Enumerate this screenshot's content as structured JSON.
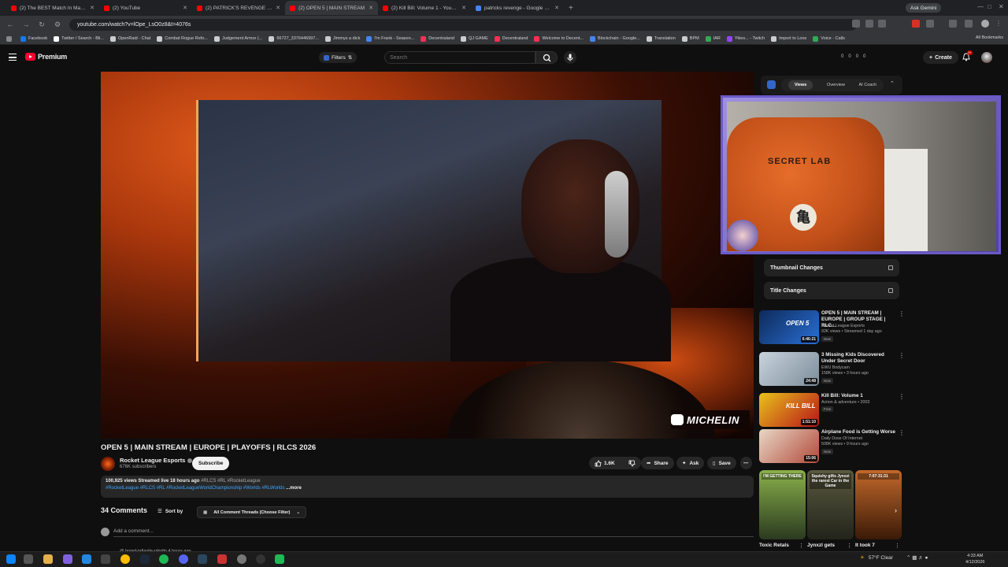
{
  "browser": {
    "tabs": [
      {
        "title": "(2) The BEST Match In Mario Ka",
        "color": "#ff0000"
      },
      {
        "title": "(2) YouTube",
        "color": "#ff0000"
      },
      {
        "title": "(2) PATRICK'S REVENGE [Ohhh",
        "color": "#ff0000"
      },
      {
        "title": "(2) OPEN 5 | MAIN STREAM",
        "color": "#ff0000",
        "active": true
      },
      {
        "title": "(2) Kill Bill: Volume 1 - YouTube",
        "color": "#ff0000"
      },
      {
        "title": "patricks revenge - Google Sear",
        "color": "#4285f4"
      }
    ],
    "new_tab": "+",
    "ask_gemini": "Ask Gemini",
    "url": "youtube.com/watch?v=lOpe_LsO0z8&t=4076s",
    "bookmarks": [
      {
        "label": "Facebook",
        "color": "#1877f2"
      },
      {
        "label": "Twitter / Search - Bli...",
        "color": "#ffffff"
      },
      {
        "label": "OpenRaid - Chat",
        "color": "#cccccc"
      },
      {
        "label": "Combat Rogue Refo...",
        "color": "#cccccc"
      },
      {
        "label": "Judgement Armor (...",
        "color": "#cccccc"
      },
      {
        "label": "66727_3376446997...",
        "color": "#cccccc"
      },
      {
        "label": "Jimmys a dick",
        "color": "#cccccc"
      },
      {
        "label": "I'm Frank - Season...",
        "color": "#4285f4"
      },
      {
        "label": "Decentraland",
        "color": "#ff2d55"
      },
      {
        "label": "QJ GAME",
        "color": "#cccccc"
      },
      {
        "label": "Decentraland",
        "color": "#ff2d55"
      },
      {
        "label": "Welcome to Decent...",
        "color": "#ff2d55"
      },
      {
        "label": "Blockchain - Google...",
        "color": "#4285f4"
      },
      {
        "label": "Translation",
        "color": "#cccccc"
      },
      {
        "label": "BPM",
        "color": "#cccccc"
      },
      {
        "label": "IAR",
        "color": "#34a853"
      },
      {
        "label": "Yikes... - Twitch",
        "color": "#9146ff"
      },
      {
        "label": "Import to Loox",
        "color": "#cccccc"
      },
      {
        "label": "Voice - Calls",
        "color": "#34a853"
      }
    ],
    "all_bookmarks": "All Bookmarks"
  },
  "youtube": {
    "logo_text": "Premium",
    "filters_label": "Filters",
    "search_placeholder": "Search",
    "header_stats": [
      "0",
      "0",
      "0",
      "0"
    ],
    "create_label": "Create",
    "notif_count": "9+"
  },
  "video": {
    "sponsor": "MICHELIN",
    "title": "OPEN 5 | MAIN STREAM | EUROPE | PLAYOFFS | RLCS 2026",
    "channel": "Rocket League Esports",
    "subscribers": "676K subscribers",
    "subscribe_label": "Subscribe",
    "likes": "1.6K",
    "share_label": "Share",
    "ask_label": "Ask",
    "save_label": "Save",
    "desc_line1_stats": "100,925 views  Streamed live 18 hours ago",
    "desc_line1_tags": "#RLCS #RL #RocketLeague",
    "desc_line2": "#RocketLeague #RLCS #RL #RocketLeagueWorldChampionship #Worlds #RLWorlds",
    "more_label": "...more"
  },
  "comments": {
    "count_label": "34 Comments",
    "sort_label": "Sort by",
    "threads_label": "All Comment Threads (Choose Filter)",
    "add_placeholder": "Add a comment...",
    "first_comment_meta": "@ bored-tafiastle-rrkisfin 4 hours ago"
  },
  "extension": {
    "tabs": [
      "Views",
      "Overview",
      "AI Coach"
    ],
    "rows": [
      "Thumbnail Changes",
      "Title Changes"
    ]
  },
  "overlay": {
    "chair_brand": "SECRET LAB",
    "emblem": "亀"
  },
  "recommendations": [
    {
      "title": "OPEN 5 | MAIN STREAM | EUROPE | GROUP STAGE | RLC...",
      "channel": "Rocket League Esports",
      "meta": "92K views • Streamed 1 day ago",
      "badge": "New",
      "duration": "6:46:21",
      "thumb_text": "OPEN 5",
      "colors": [
        "#0d2a5a",
        "#2a6fd6"
      ]
    },
    {
      "title": "3 Missing Kids Discovered Under Secret Door",
      "channel": "EWU Bodycam",
      "meta": "158K views • 3 hours ago",
      "badge": "New",
      "duration": "24:48",
      "thumb_text": "",
      "colors": [
        "#c8d3dc",
        "#7c8d9a"
      ]
    },
    {
      "title": "Kill Bill: Volume 1",
      "channel": "Action & adventure • 2003",
      "meta": "",
      "badge": "Free",
      "duration": "1:51:10",
      "thumb_text": "KILL BILL",
      "colors": [
        "#e8c21a",
        "#b8141a"
      ]
    },
    {
      "title": "Airplane Food is Getting Worse",
      "channel": "Daily Dose Of Internet",
      "meta": "508K views • 9 hours ago",
      "badge": "New",
      "duration": "15:06",
      "thumb_text": "",
      "colors": [
        "#e8d7c6",
        "#b24a3a"
      ]
    }
  ],
  "shorts": [
    {
      "title": "Toxic Retals",
      "caption": "I'M GETTING THERE",
      "colors": [
        "#8ab04a",
        "#2a3a20"
      ]
    },
    {
      "title": "Jynxzl gets",
      "caption": "Squishy gifts Jynxzi the rarest Car in the Game",
      "colors": [
        "#5a5a40",
        "#22241a"
      ]
    },
    {
      "title": "It took 7",
      "caption": "7:07:31:31",
      "colors": [
        "#c2682a",
        "#3a1a08"
      ]
    }
  ],
  "taskbar": {
    "weather": "57°F  Clear",
    "time": "4:33 AM",
    "date": "4/12/2026"
  }
}
